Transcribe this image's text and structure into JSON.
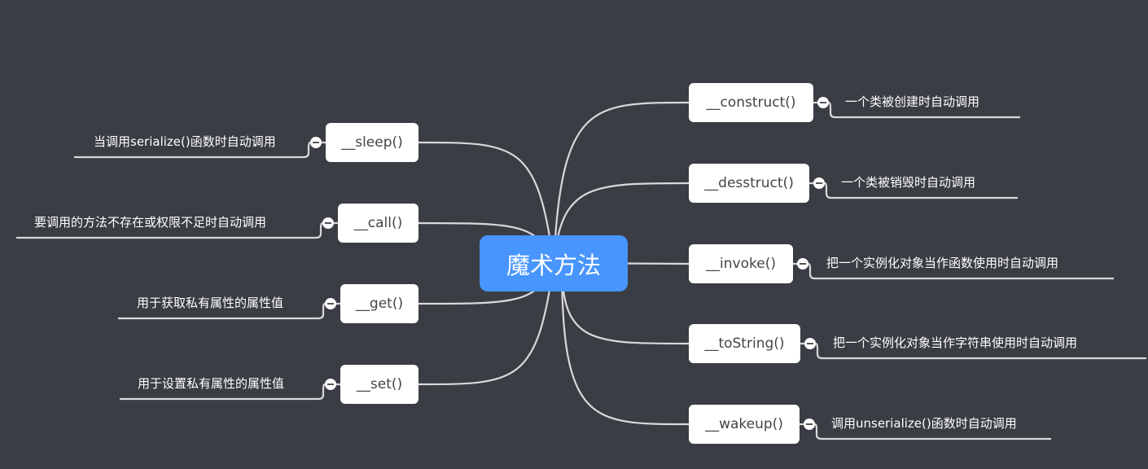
{
  "root": {
    "label": "魔术方法",
    "color": "#4795fd"
  },
  "right": [
    {
      "method": "__construct()",
      "note": "一个类被创建时自动调用"
    },
    {
      "method": "__desstruct()",
      "note": "一个类被销毁时自动调用"
    },
    {
      "method": "__invoke()",
      "note": "把一个实例化对象当作函数使用时自动调用"
    },
    {
      "method": "__toString()",
      "note": "把一个实例化对象当作字符串使用时自动调用"
    },
    {
      "method": "__wakeup()",
      "note": "调用unserialize()函数时自动调用"
    }
  ],
  "left": [
    {
      "method": "__sleep()",
      "note": "当调用serialize()函数时自动调用"
    },
    {
      "method": "__call()",
      "note": "要调用的方法不存在或权限不足时自动调用"
    },
    {
      "method": "__get()",
      "note": "用于获取私有属性的属性值"
    },
    {
      "method": "__set()",
      "note": "用于设置私有属性的属性值"
    }
  ],
  "colors": {
    "background": "#3a3d43",
    "edge": "#d9d9d9",
    "node": "#ffffff"
  }
}
